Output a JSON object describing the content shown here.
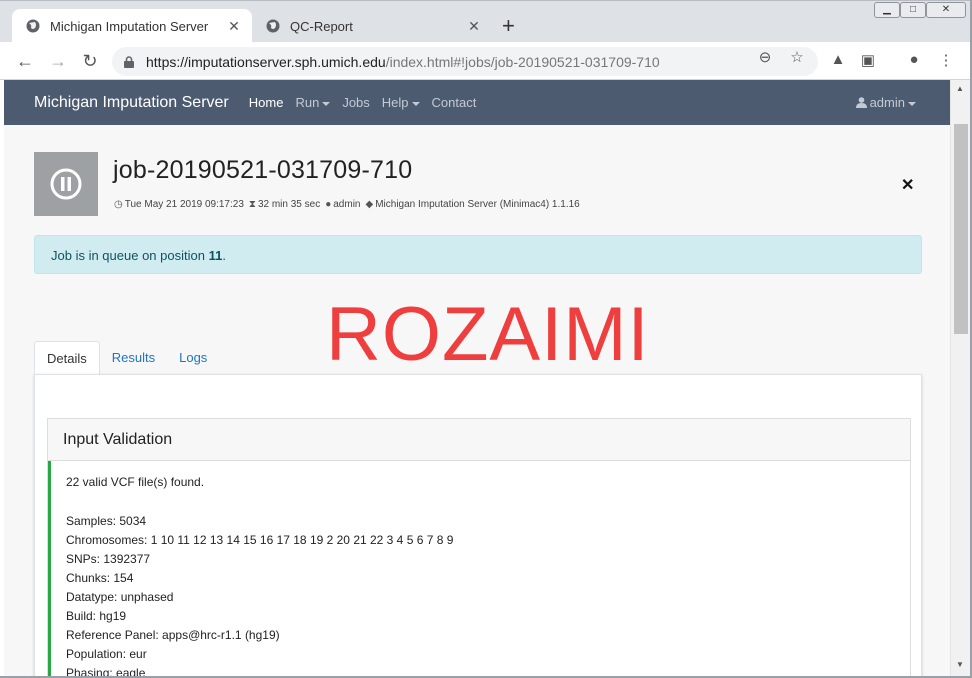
{
  "browser": {
    "tabs": [
      {
        "title": "Michigan Imputation Server",
        "active": true
      },
      {
        "title": "QC-Report",
        "active": false
      }
    ],
    "url_host": "https://imputationserver.sph.umich.edu",
    "url_path": "/index.html#!jobs/job-20190521-031709-710"
  },
  "navbar": {
    "brand": "Michigan Imputation Server",
    "items": [
      "Home",
      "Run",
      "Jobs",
      "Help",
      "Contact"
    ],
    "user": "admin"
  },
  "job": {
    "title": "job-20190521-031709-710",
    "date": "Tue May 21 2019 09:17:23",
    "duration": "32 min 35 sec",
    "user": "admin",
    "app": "Michigan Imputation Server (Minimac4) 1.1.16"
  },
  "alert": {
    "prefix": "Job is in queue on position ",
    "position": "11",
    "suffix": "."
  },
  "watermark": "ROZAIMI",
  "tabs": [
    "Details",
    "Results",
    "Logs"
  ],
  "validation": {
    "header": "Input Validation",
    "found": "22 valid VCF file(s) found.",
    "lines": [
      "Samples: 5034",
      "Chromosomes: 1 10 11 12 13 14 15 16 17 18 19 2 20 21 22 3 4 5 6 7 8 9",
      "SNPs: 1392377",
      "Chunks: 154",
      "Datatype: unphased",
      "Build: hg19",
      "Reference Panel: apps@hrc-r1.1 (hg19)",
      "Population: eur",
      "Phasing: eagle"
    ]
  },
  "colors": {
    "navbar": "#4d5b70",
    "alert_bg": "#d1ecf1",
    "watermark": "#ee3e3e",
    "success_border": "#28a745",
    "link": "#1f75c4"
  }
}
